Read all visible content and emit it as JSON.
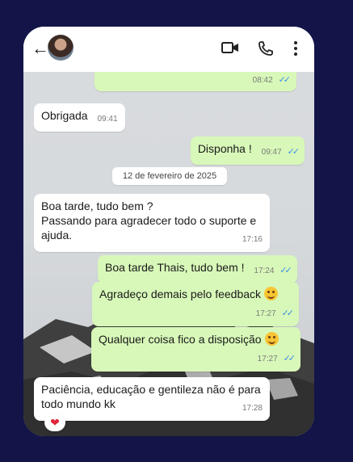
{
  "header": {
    "contact_name": ""
  },
  "messages": [
    {
      "id": "m1",
      "dir": "out",
      "text": "",
      "time": "08:42",
      "ticks": "✓✓"
    },
    {
      "id": "m2",
      "dir": "in",
      "text": "Obrigada",
      "time": "09:41"
    },
    {
      "id": "m3",
      "dir": "out",
      "text": "Disponha !",
      "time": "09:47",
      "ticks": "✓✓"
    },
    {
      "id": "m4",
      "dir": "in",
      "text": "Boa tarde, tudo bem ?\nPassando para agradecer todo o suporte e ajuda.",
      "time": "17:16"
    },
    {
      "id": "m5",
      "dir": "out",
      "text": "Boa tarde Thais, tudo bem !",
      "time": "17:24",
      "ticks": "✓✓"
    },
    {
      "id": "m6",
      "dir": "out",
      "text": "Agradeço demais pelo feedback",
      "emoji": "smiling-face-icon",
      "time": "17:27",
      "ticks": "✓✓"
    },
    {
      "id": "m7",
      "dir": "out",
      "text": "Qualquer coisa fico a disposição",
      "emoji": "relieved-face-icon",
      "time": "17:27",
      "ticks": "✓✓"
    },
    {
      "id": "m8",
      "dir": "in",
      "text": "Paciência, educação e gentileza não é para todo mundo kk",
      "time": "17:28",
      "reaction": "heart-icon"
    }
  ],
  "date_separator": "12 de fevereiro de 2025",
  "colors": {
    "background": "#131548",
    "outgoing": "#d8f8b9",
    "incoming": "#ffffff",
    "ticks": "#3c8de8"
  }
}
